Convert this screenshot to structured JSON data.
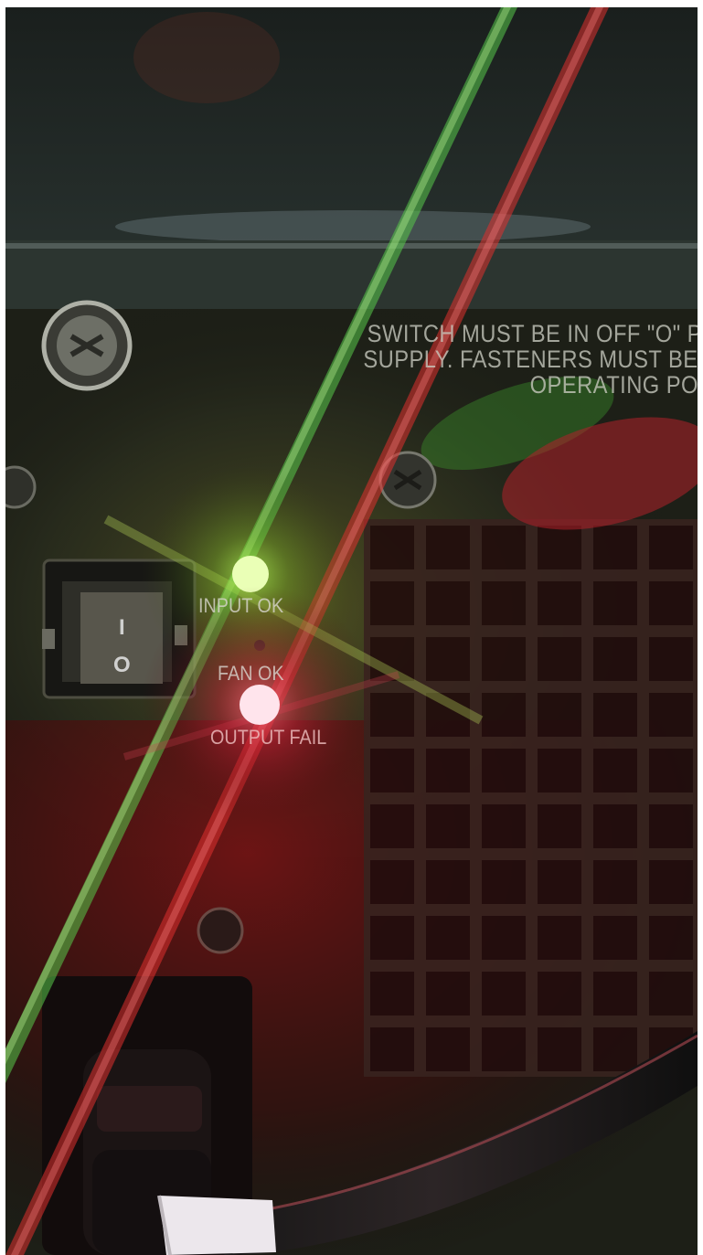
{
  "warning_text": [
    "SWITCH MUST BE IN OFF \"O\" POS",
    "SUPPLY.  FASTENERS MUST BE FU",
    "OPERATING POWE"
  ],
  "led_labels": {
    "input": "INPUT OK",
    "fan": "FAN OK",
    "output": "OUTPUT FAIL"
  },
  "led_states": {
    "input": "on",
    "fan": "off",
    "output": "on"
  },
  "switch_marks": {
    "on": "I",
    "off": "O"
  },
  "colors": {
    "input_led": "#a8ff4a",
    "output_led": "#ff2a48",
    "panel": "#2b2d20",
    "label_text": "#d9d6cf"
  }
}
